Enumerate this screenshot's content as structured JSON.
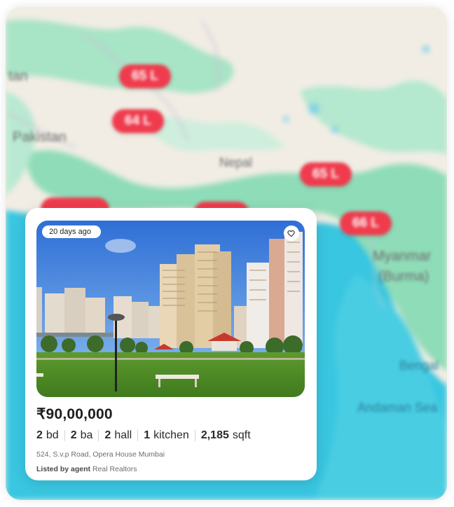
{
  "map": {
    "labels": {
      "afghanistan": "tan",
      "pakistan": "Pakistan",
      "nepal": "Nepal",
      "myanmar": "Myanmar",
      "burma": "(Burma)",
      "bengal": "Bengal",
      "andaman": "Andaman Sea"
    },
    "pins": [
      "65 L",
      "64 L",
      "65 L",
      "66 L"
    ]
  },
  "card": {
    "posted_ago": "20 days ago",
    "price": "₹90,00,000",
    "specs": [
      {
        "value": "2",
        "unit": "bd"
      },
      {
        "value": "2",
        "unit": "ba"
      },
      {
        "value": "2",
        "unit": "hall"
      },
      {
        "value": "1",
        "unit": "kitchen"
      },
      {
        "value": "2,185",
        "unit": "sqft"
      }
    ],
    "address": "524, S.v.p Road, Opera House Mumbai",
    "listed_label": "Listed by agent",
    "agent_name": "Real Realtors"
  },
  "colors": {
    "pin": "#ef3b4d",
    "sea": "#39c6e0",
    "land": "#f1ede4",
    "vegetation": "#8fdcb8"
  },
  "icons": {
    "favorite": "heart-outline-icon"
  }
}
